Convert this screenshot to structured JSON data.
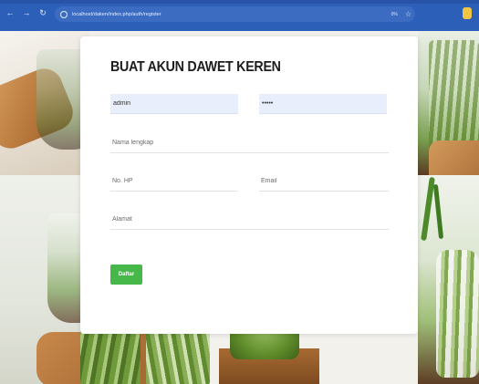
{
  "browser": {
    "url": "localhost/daken/index.php/auth/register",
    "back_icon": "arrow-left-icon",
    "forward_icon": "arrow-right-icon",
    "reload_icon": "reload-icon",
    "site_info_icon": "info-icon",
    "bookmark_icon": "star-icon",
    "zoom_text": "0%"
  },
  "form": {
    "title": "BUAT AKUN DAWET KEREN",
    "username_value": "admin",
    "password_value": "admin",
    "fullname_placeholder": "Nama lengkap",
    "phone_placeholder": "No. HP",
    "email_placeholder": "Email",
    "address_placeholder": "Alamat",
    "submit_label": "Daftar"
  },
  "colors": {
    "chrome": "#2c5fb8",
    "submit": "#46b84a",
    "autofill": "#e8eefc"
  }
}
